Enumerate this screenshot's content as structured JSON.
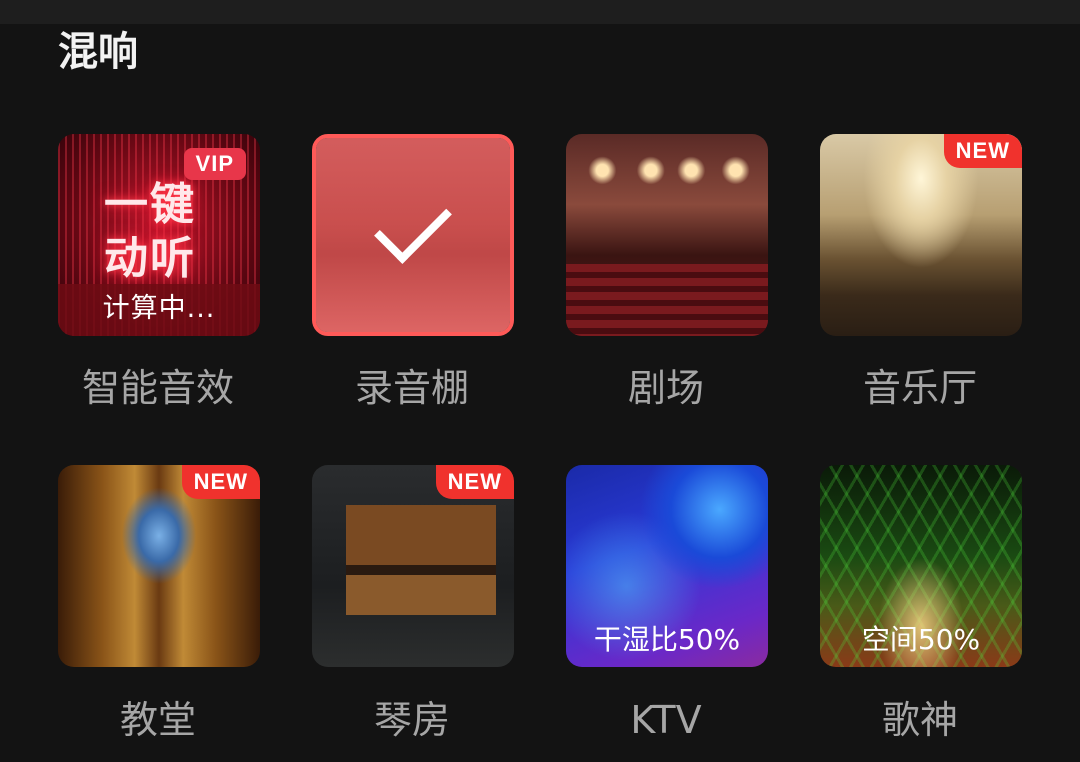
{
  "section": {
    "title": "混响"
  },
  "colors": {
    "background": "#131313",
    "label": "#a6a6a6",
    "new_badge": "#f0322d",
    "selected_border": "#ff5a58"
  },
  "presets": [
    {
      "label": "智能音效",
      "badge": "VIP",
      "art_text": "一键\n动听",
      "status": "计算中...",
      "selected": false,
      "icon": "smart-effect-art"
    },
    {
      "label": "录音棚",
      "badge": "",
      "selected": true,
      "icon": "studio-art"
    },
    {
      "label": "剧场",
      "badge": "",
      "selected": false,
      "icon": "theater-art"
    },
    {
      "label": "音乐厅",
      "badge": "NEW",
      "selected": false,
      "icon": "concert-hall-art"
    },
    {
      "label": "教堂",
      "badge": "NEW",
      "selected": false,
      "icon": "church-art"
    },
    {
      "label": "琴房",
      "badge": "NEW",
      "selected": false,
      "icon": "piano-room-art"
    },
    {
      "label": "KTV",
      "badge": "",
      "overlay": "干湿比50%",
      "selected": false,
      "icon": "ktv-art"
    },
    {
      "label": "歌神",
      "badge": "",
      "overlay": "空间50%",
      "selected": false,
      "icon": "singer-art"
    }
  ]
}
